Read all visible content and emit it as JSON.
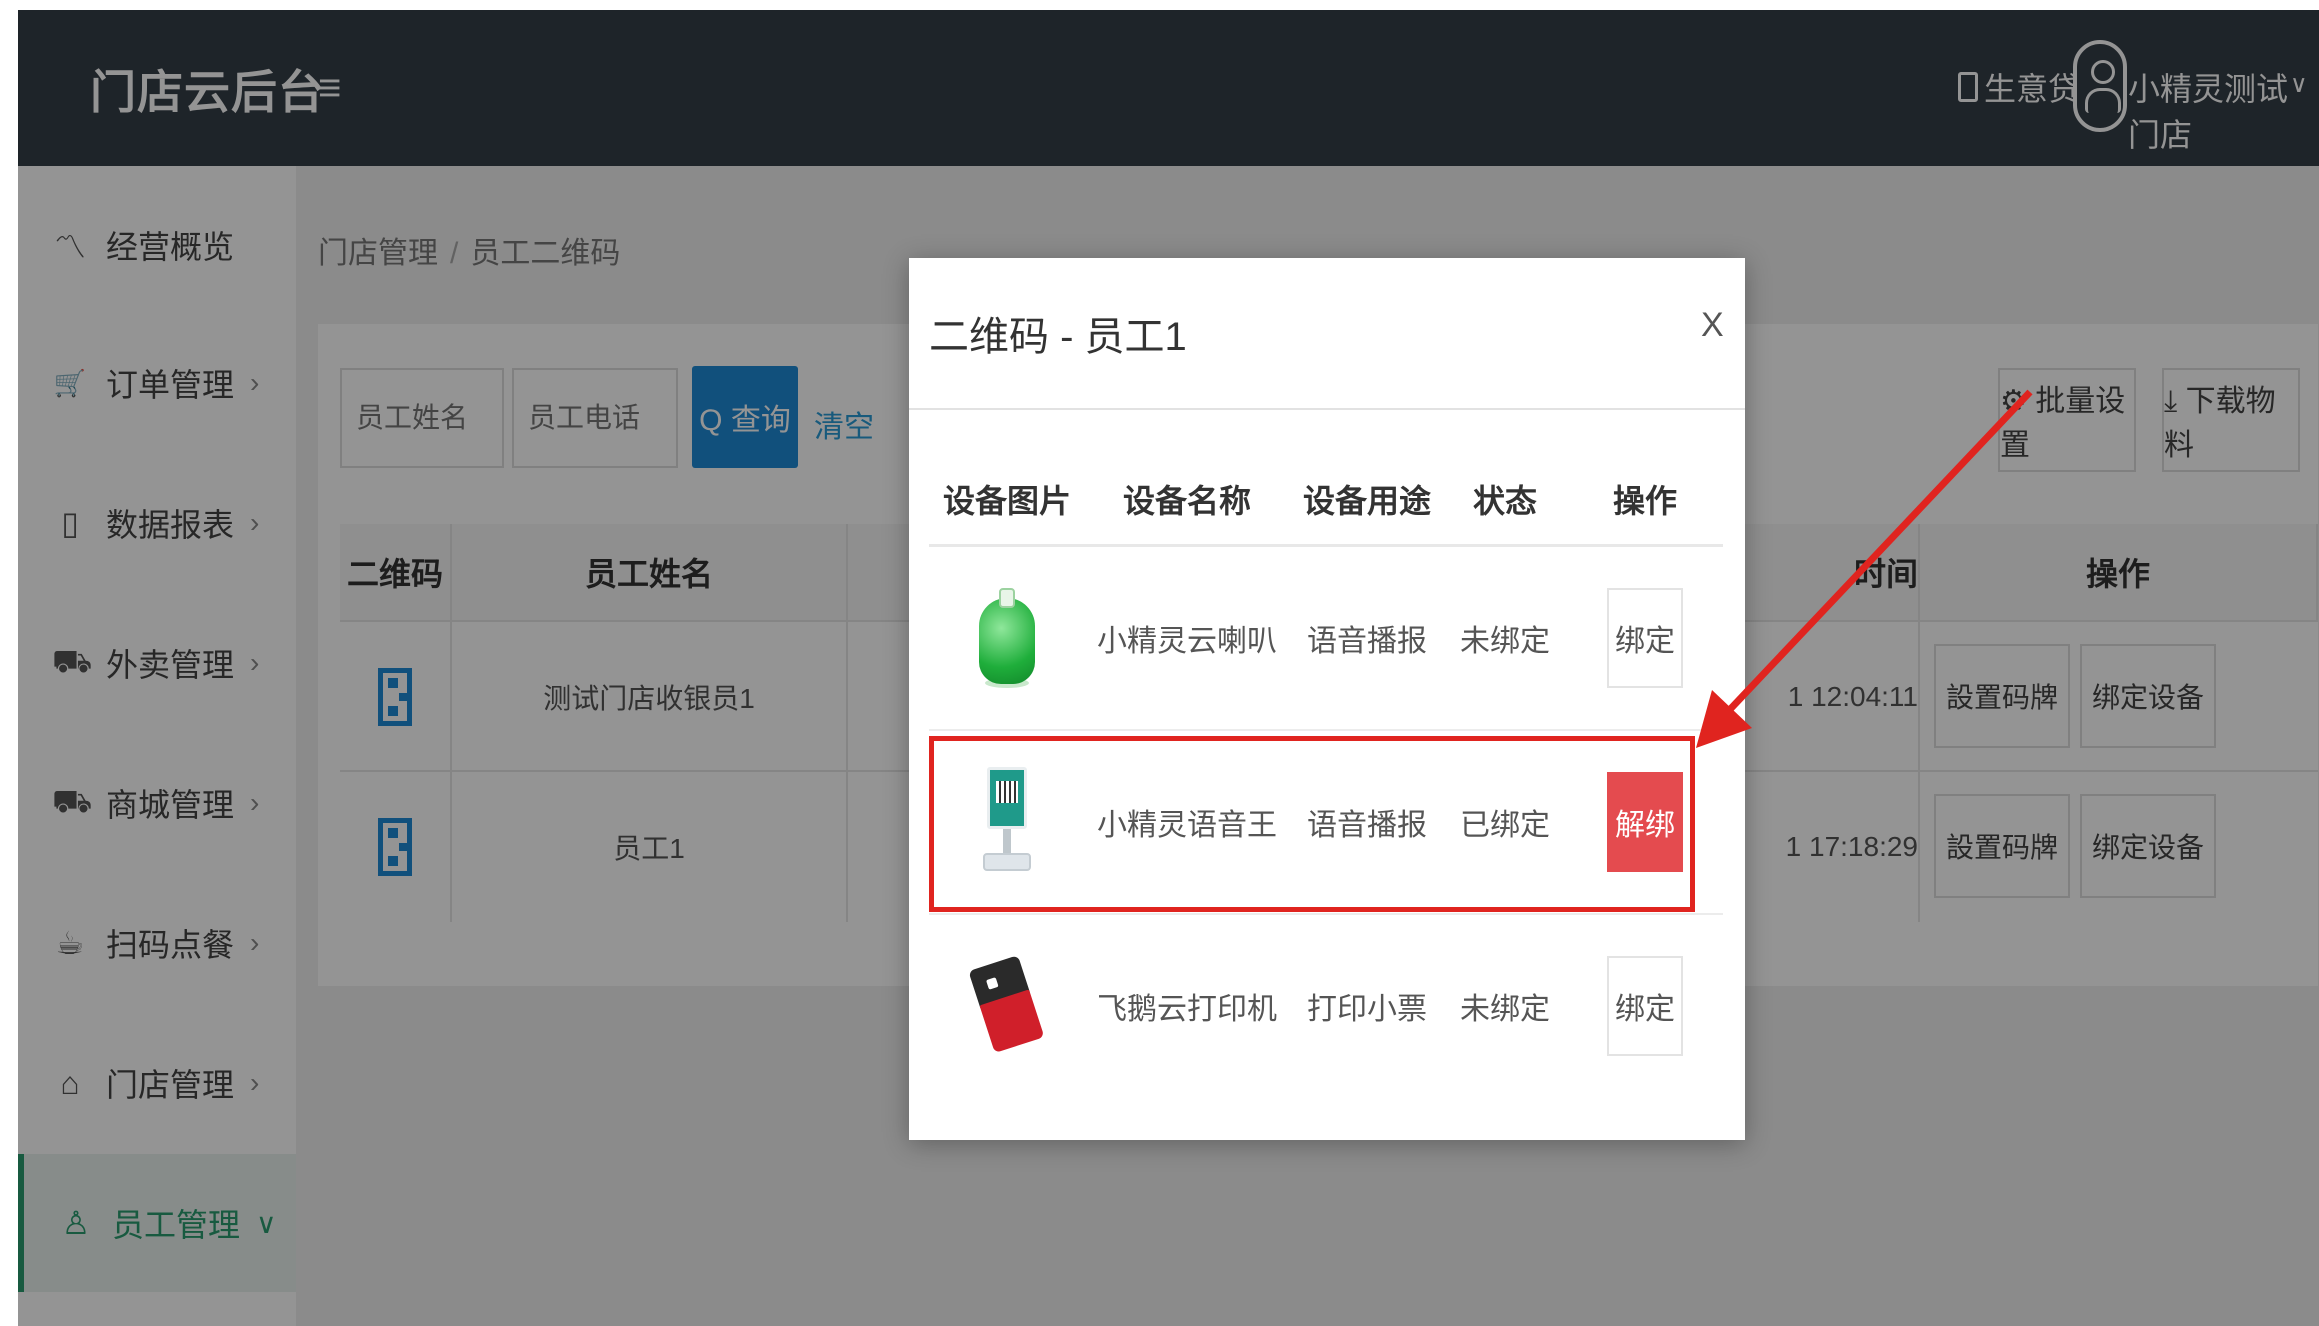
{
  "header": {
    "brand": "门店云后台",
    "menu_icon": "≡",
    "loan_label": "生意贷",
    "user_name": "小精灵测试门店",
    "user_caret": "∨"
  },
  "sidebar": {
    "items": [
      {
        "icon": "〽",
        "label": "经营概览",
        "arrow": ""
      },
      {
        "icon": "🛒",
        "label": "订单管理",
        "arrow": "›"
      },
      {
        "icon": "▯",
        "label": "数据报表",
        "arrow": "›"
      },
      {
        "icon": "⛟",
        "label": "外卖管理",
        "arrow": "›"
      },
      {
        "icon": "⛟",
        "label": "商城管理",
        "arrow": "›"
      },
      {
        "icon": "☕",
        "label": "扫码点餐",
        "arrow": "›"
      },
      {
        "icon": "⌂",
        "label": "门店管理",
        "arrow": "›"
      },
      {
        "icon": "♙",
        "label": "员工管理",
        "arrow": "∨"
      }
    ]
  },
  "breadcrumb": {
    "parent": "门店管理",
    "sep": "/",
    "current": "员工二维码"
  },
  "filters": {
    "name_placeholder": "员工姓名",
    "phone_placeholder": "员工电话",
    "query_label": "Q 查询",
    "clear_label": "清空",
    "batch_label": "⚙ 批量设置",
    "download_label": "⤓ 下载物料"
  },
  "table": {
    "headers": {
      "qr": "二维码",
      "name": "员工姓名",
      "time": "时间",
      "ops": "操作"
    },
    "rows": [
      {
        "name": "测试门店收银员1",
        "time": "1 12:04:11",
        "btn_code": "設置码牌",
        "btn_bind": "绑定设备"
      },
      {
        "name": "员工1",
        "time": "1 17:18:29",
        "btn_code": "設置码牌",
        "btn_bind": "绑定设备"
      }
    ]
  },
  "modal": {
    "title": "二维码 - 员工1",
    "close": "X",
    "headers": [
      "设备图片",
      "设备名称",
      "设备用途",
      "状态",
      "操作"
    ],
    "rows": [
      {
        "device": "小精灵云喇叭",
        "use": "语音播报",
        "status": "未绑定",
        "action": "绑定",
        "danger": false
      },
      {
        "device": "小精灵语音王",
        "use": "语音播报",
        "status": "已绑定",
        "action": "解绑",
        "danger": true
      },
      {
        "device": "飞鹅云打印机",
        "use": "打印小票",
        "status": "未绑定",
        "action": "绑定",
        "danger": false
      }
    ]
  },
  "colors": {
    "header": "#353e47",
    "accent": "#2a9c6e",
    "primary": "#1e8ad6",
    "danger": "#e44b4f",
    "annotation": "#e0241f"
  }
}
